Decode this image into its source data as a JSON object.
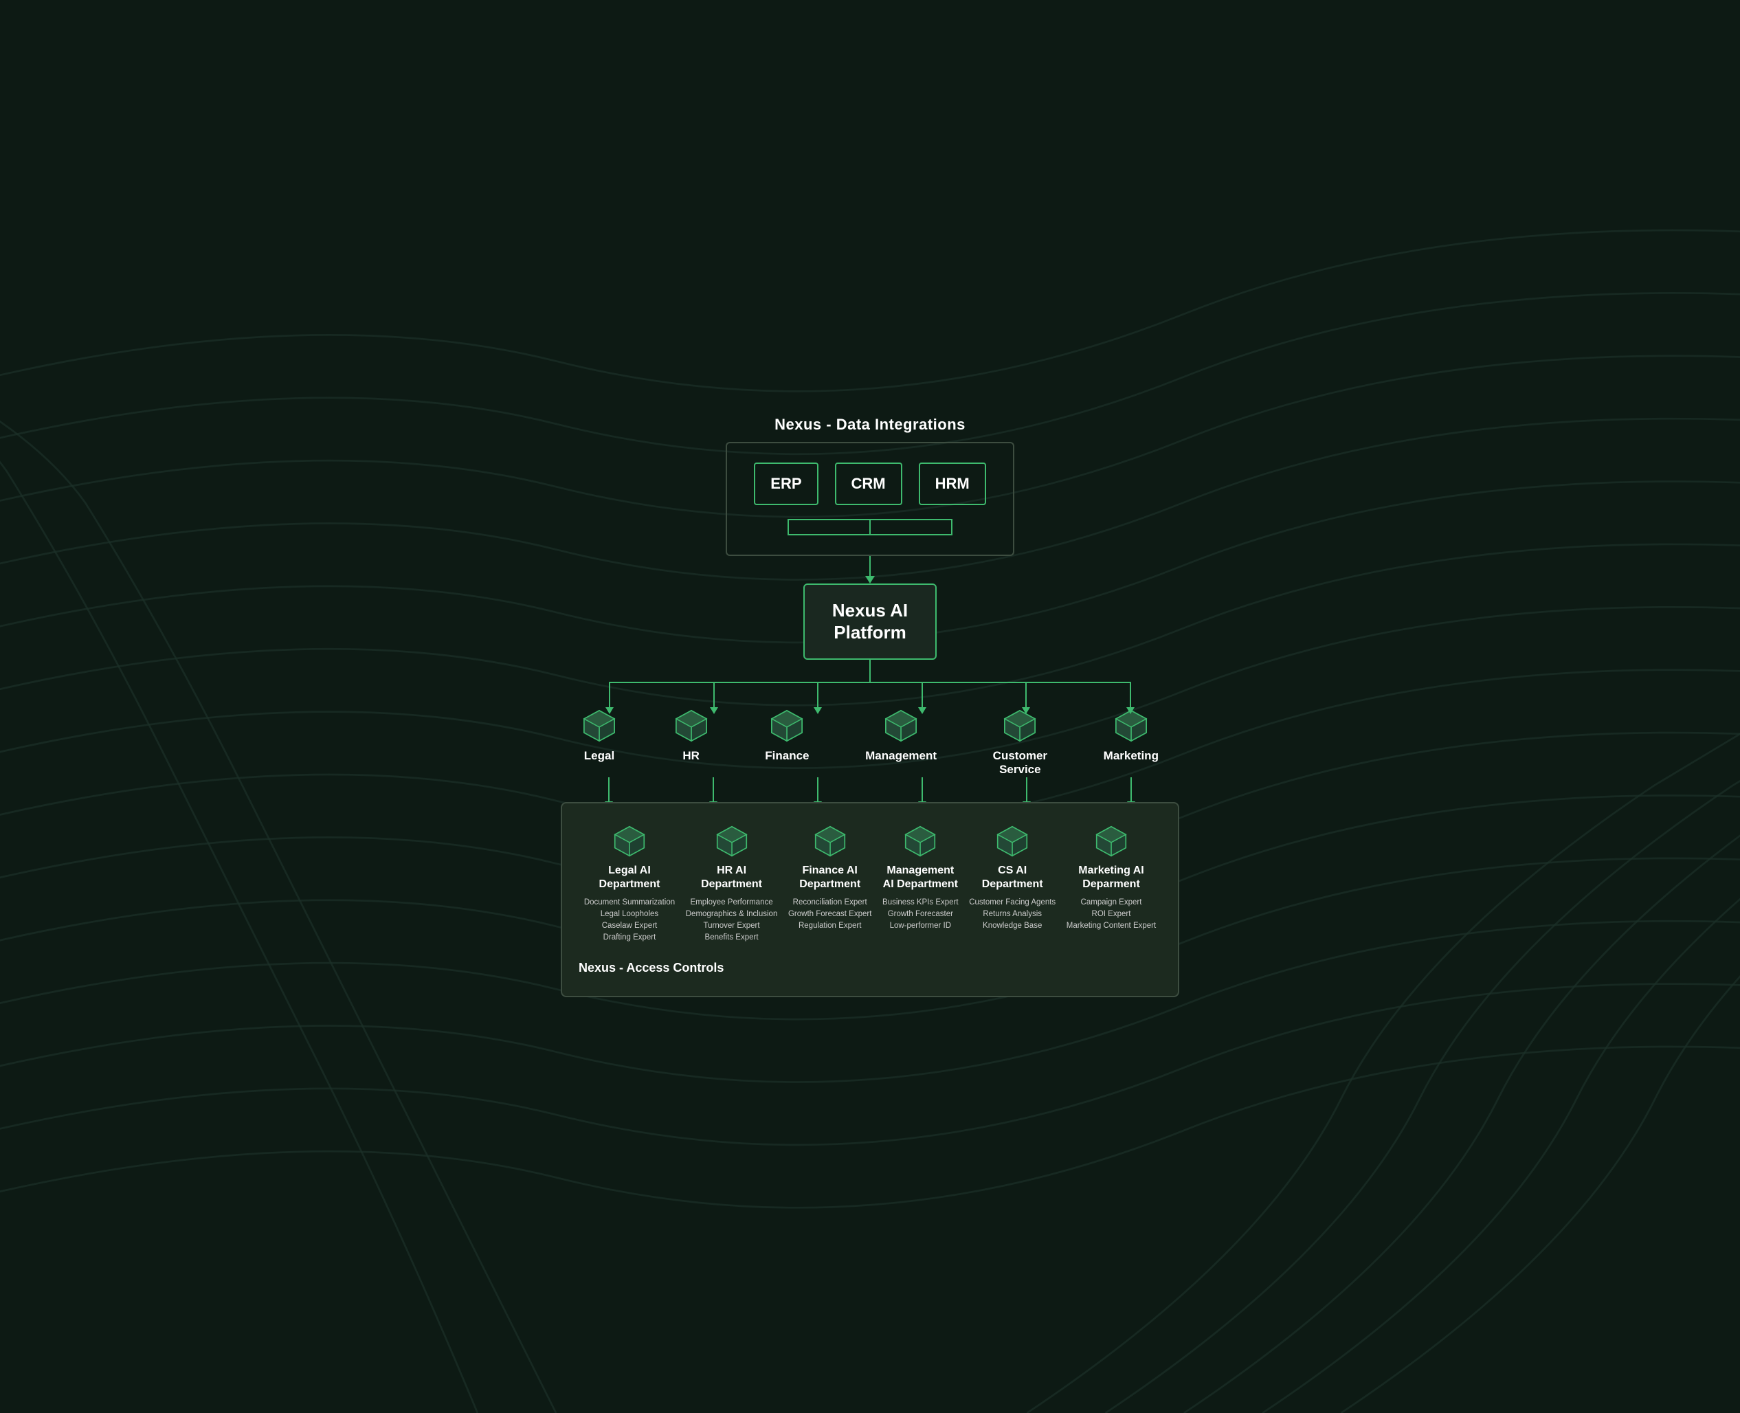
{
  "diagram": {
    "topTitle": "Nexus - Data Integrations",
    "integrations": {
      "items": [
        "ERP",
        "CRM",
        "HRM"
      ]
    },
    "platform": {
      "title": "Nexus AI\nPlatform"
    },
    "departments": [
      {
        "id": "legal",
        "label": "Legal"
      },
      {
        "id": "hr",
        "label": "HR"
      },
      {
        "id": "finance",
        "label": "Finance"
      },
      {
        "id": "management",
        "label": "Management"
      },
      {
        "id": "cs",
        "label": "Customer\nService"
      },
      {
        "id": "marketing",
        "label": "Marketing"
      }
    ],
    "aiDepartments": [
      {
        "id": "legal-ai",
        "title": "Legal AI\nDepartment",
        "details": "Document Summarization\nLegal Loopholes\nCaselaw Expert\nDrafting Expert"
      },
      {
        "id": "hr-ai",
        "title": "HR AI\nDepartment",
        "details": "Employee Performance\nDemographics & Inclusion\nTurnover Expert\nBenefits Expert"
      },
      {
        "id": "finance-ai",
        "title": "Finance AI\nDepartment",
        "details": "Reconciliation Expert\nGrowth Forecast Expert\nRegulation Expert"
      },
      {
        "id": "management-ai",
        "title": "Management\nAI Department",
        "details": "Business KPIs Expert\nGrowth Forecaster\nLow-performer ID"
      },
      {
        "id": "cs-ai",
        "title": "CS AI\nDepartment",
        "details": "Customer Facing Agents\nReturns Analysis\nKnowledge Base"
      },
      {
        "id": "marketing-ai",
        "title": "Marketing AI\nDeparment",
        "details": "Campaign Expert\nROI Expert\nMarketing Content Expert"
      }
    ],
    "bottomLabel": "Nexus - Access Controls"
  },
  "colors": {
    "green": "#3eba6e",
    "darkBg": "#0d1a14",
    "panelBg": "#1c2a1f",
    "borderDark": "#3d4d40"
  }
}
